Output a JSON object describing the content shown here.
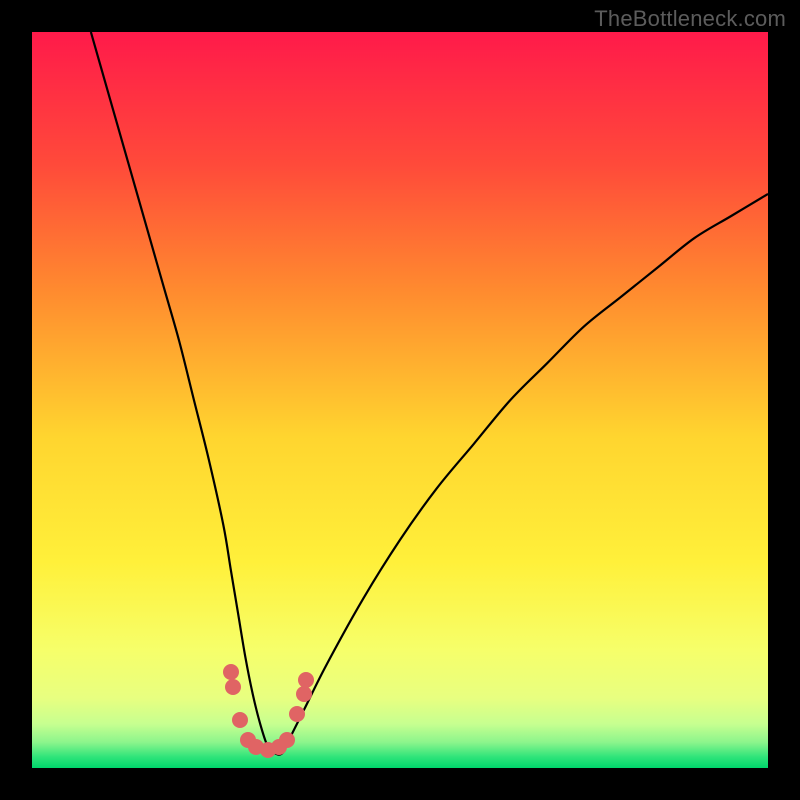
{
  "watermark": "TheBottleneck.com",
  "chart_data": {
    "type": "line",
    "title": "",
    "xlabel": "",
    "ylabel": "",
    "xlim": [
      0,
      100
    ],
    "ylim": [
      0,
      100
    ],
    "grid": false,
    "legend": false,
    "colors": {
      "gradient_top": "#ff1a4a",
      "gradient_mid_upper": "#ff7a2f",
      "gradient_mid": "#ffe432",
      "gradient_lower": "#f6ff6a",
      "gradient_band": "#d6ff87",
      "gradient_bottom": "#00e676",
      "curve": "#000000",
      "marker": "#e06464"
    },
    "series": [
      {
        "name": "bottleneck-curve",
        "x": [
          8,
          10,
          12,
          14,
          16,
          18,
          20,
          22,
          24,
          26,
          27,
          28,
          29,
          30,
          31,
          32,
          33,
          34,
          35,
          37,
          40,
          45,
          50,
          55,
          60,
          65,
          70,
          75,
          80,
          85,
          90,
          95,
          100
        ],
        "y": [
          100,
          93,
          86,
          79,
          72,
          65,
          58,
          50,
          42,
          33,
          27,
          21,
          15,
          10,
          6,
          3,
          2,
          2,
          4,
          8,
          14,
          23,
          31,
          38,
          44,
          50,
          55,
          60,
          64,
          68,
          72,
          75,
          78
        ]
      }
    ],
    "markers": [
      {
        "x": 27.0,
        "y": 13.0
      },
      {
        "x": 27.3,
        "y": 11.0
      },
      {
        "x": 28.2,
        "y": 6.5
      },
      {
        "x": 29.3,
        "y": 3.8
      },
      {
        "x": 30.5,
        "y": 2.8
      },
      {
        "x": 32.0,
        "y": 2.5
      },
      {
        "x": 33.5,
        "y": 2.8
      },
      {
        "x": 34.7,
        "y": 3.8
      },
      {
        "x": 36.0,
        "y": 7.3
      },
      {
        "x": 37.0,
        "y": 10.0
      },
      {
        "x": 37.2,
        "y": 12.0
      }
    ],
    "gradient_stops": [
      {
        "offset": 0,
        "color": "#ff1a4a"
      },
      {
        "offset": 0.18,
        "color": "#ff4a3a"
      },
      {
        "offset": 0.35,
        "color": "#ff8a2f"
      },
      {
        "offset": 0.55,
        "color": "#ffd52f"
      },
      {
        "offset": 0.72,
        "color": "#fff03a"
      },
      {
        "offset": 0.84,
        "color": "#f6ff6a"
      },
      {
        "offset": 0.905,
        "color": "#e8ff80"
      },
      {
        "offset": 0.94,
        "color": "#c7ff90"
      },
      {
        "offset": 0.965,
        "color": "#8cf58c"
      },
      {
        "offset": 0.985,
        "color": "#2fe47a"
      },
      {
        "offset": 1.0,
        "color": "#00d66b"
      }
    ]
  }
}
